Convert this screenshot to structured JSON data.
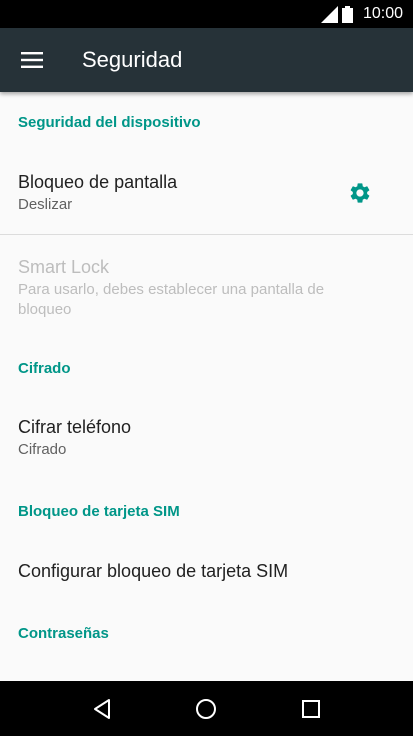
{
  "status_bar": {
    "time": "10:00"
  },
  "app_bar": {
    "title": "Seguridad"
  },
  "sections": {
    "device_security": {
      "header": "Seguridad del dispositivo",
      "screen_lock": {
        "title": "Bloqueo de pantalla",
        "summary": "Deslizar"
      },
      "smart_lock": {
        "title": "Smart Lock",
        "summary": "Para usarlo, debes establecer una pantalla de bloqueo"
      }
    },
    "encryption": {
      "header": "Cifrado",
      "encrypt_phone": {
        "title": "Cifrar teléfono",
        "summary": "Cifrado"
      }
    },
    "sim_lock": {
      "header": "Bloqueo de tarjeta SIM",
      "configure": {
        "title": "Configurar bloqueo de tarjeta SIM"
      }
    },
    "passwords": {
      "header": "Contraseñas"
    }
  },
  "colors": {
    "accent": "#009688",
    "app_bar": "#263238",
    "background": "#fafafa"
  },
  "icons": [
    "signal-icon",
    "battery-icon",
    "menu-icon",
    "gear-icon",
    "back-icon",
    "home-icon",
    "recents-icon"
  ]
}
